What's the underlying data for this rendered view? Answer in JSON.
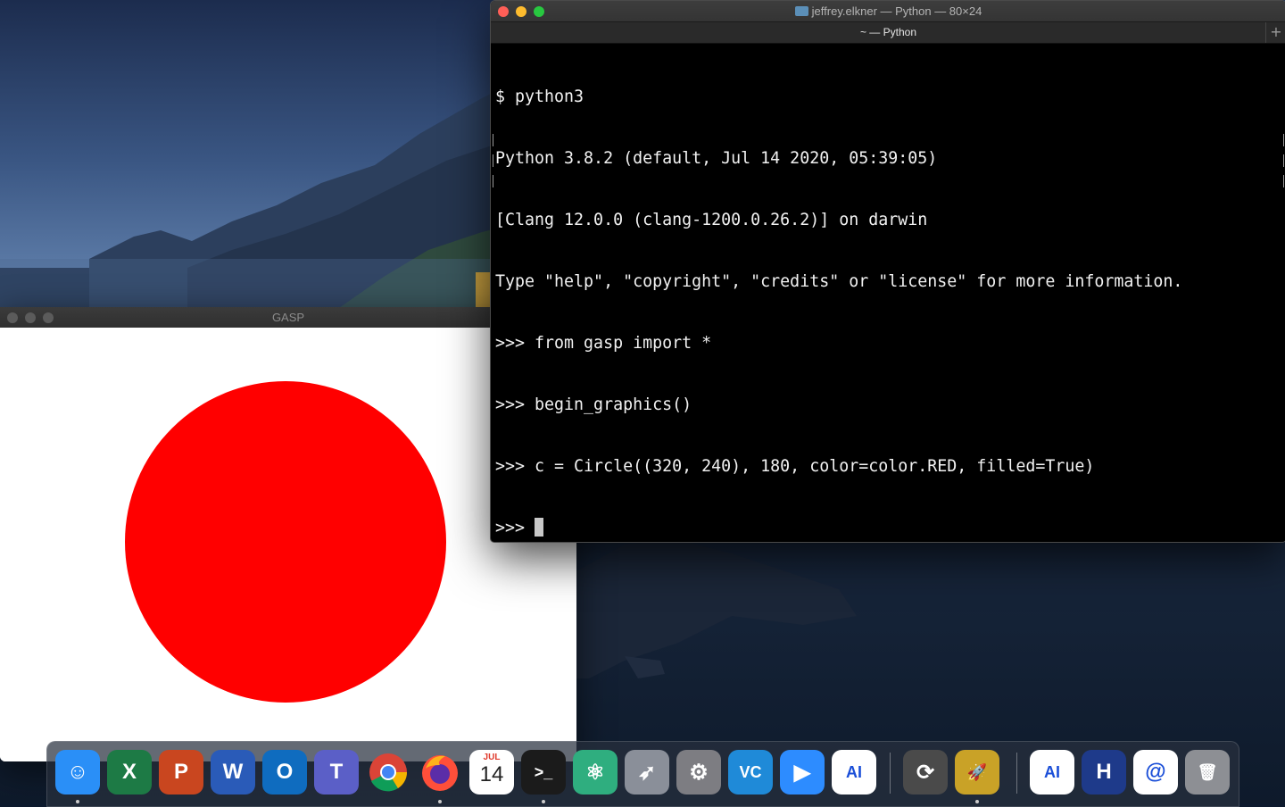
{
  "gasp_window": {
    "title": "GASP",
    "circle": {
      "color": "#ff0000",
      "filled": true
    }
  },
  "terminal": {
    "window_title": "jeffrey.elkner — Python — 80×24",
    "tab_title": "~ — Python",
    "lines": [
      "$ python3",
      "Python 3.8.2 (default, Jul 14 2020, 05:39:05)",
      "[Clang 12.0.0 (clang-1200.0.26.2)] on darwin",
      "Type \"help\", \"copyright\", \"credits\" or \"license\" for more information.",
      ">>> from gasp import *",
      ">>> begin_graphics()",
      ">>> c = Circle((320, 240), 180, color=color.RED, filled=True)"
    ],
    "prompt": ">>> "
  },
  "dock": {
    "apps": [
      {
        "name": "Finder",
        "icon": "finder-icon",
        "glyph": "☺",
        "color": "#2a8ff7",
        "running": true
      },
      {
        "name": "Excel",
        "icon": "excel-icon",
        "glyph": "X",
        "color": "#1d7a45",
        "running": false
      },
      {
        "name": "PowerPoint",
        "icon": "powerpoint-icon",
        "glyph": "P",
        "color": "#c9461f",
        "running": false
      },
      {
        "name": "Word",
        "icon": "word-icon",
        "glyph": "W",
        "color": "#2a5bb8",
        "running": false
      },
      {
        "name": "Outlook",
        "icon": "outlook-icon",
        "glyph": "O",
        "color": "#0f6cbf",
        "running": false
      },
      {
        "name": "Teams",
        "icon": "teams-icon",
        "glyph": "T",
        "color": "#5b5fc7",
        "running": false
      },
      {
        "name": "Chrome",
        "icon": "chrome-icon",
        "glyph": "",
        "color": "#ffffff",
        "running": false
      },
      {
        "name": "Firefox",
        "icon": "firefox-icon",
        "glyph": "",
        "color": "#ff7a1a",
        "running": true
      },
      {
        "name": "Calendar",
        "icon": "calendar-icon",
        "glyph": "14",
        "month": "JUL",
        "color": "#ffffff",
        "running": false
      },
      {
        "name": "Terminal",
        "icon": "terminal-icon",
        "glyph": ">_",
        "color": "#1b1b1b",
        "running": true
      },
      {
        "name": "Atom",
        "icon": "atom-icon",
        "glyph": "⚛",
        "color": "#2fae7f",
        "running": false
      },
      {
        "name": "Launchpad",
        "icon": "rocket-icon",
        "glyph": "➶",
        "color": "#8a8f99",
        "running": false
      },
      {
        "name": "System Preferences",
        "icon": "gear-icon",
        "glyph": "⚙",
        "color": "#7d7d82",
        "running": false
      },
      {
        "name": "VS Code",
        "icon": "vscode-icon",
        "glyph": "VC",
        "color": "#1f8ad8",
        "running": false
      },
      {
        "name": "Zoom",
        "icon": "zoom-icon",
        "glyph": "▶",
        "color": "#2d8cff",
        "running": false
      },
      {
        "name": "Android Studio",
        "icon": "android-studio-icon",
        "glyph": "AI",
        "color": "#ffffff",
        "running": false
      },
      {
        "name": "Sync",
        "icon": "sync-icon",
        "glyph": "⟳",
        "color": "#4a4a4a",
        "running": false
      },
      {
        "name": "Python Launcher",
        "icon": "python-rocket-icon",
        "glyph": "🚀",
        "color": "#c9a227",
        "running": true
      },
      {
        "name": "Android Studio (2)",
        "icon": "android-studio-icon-2",
        "glyph": "AI",
        "color": "#ffffff",
        "running": false
      },
      {
        "name": "H",
        "icon": "h-app-icon",
        "glyph": "H",
        "color": "#1e3a8a",
        "running": false
      },
      {
        "name": "Mail @",
        "icon": "at-sign-icon",
        "glyph": "@",
        "color": "#ffffff",
        "running": false
      },
      {
        "name": "Trash",
        "icon": "trash-icon",
        "glyph": "🗑",
        "color": "#8d8f94",
        "running": false
      }
    ]
  }
}
